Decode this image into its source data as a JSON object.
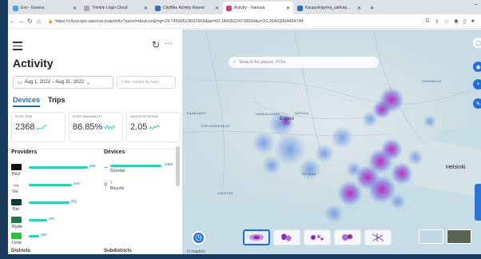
{
  "browser": {
    "tabs": [
      {
        "label": "Esri - Etusivu",
        "color": "#4aa3df",
        "active": false
      },
      {
        "label": "Trimble Login Cloud",
        "color": "#aaaaaa",
        "active": false
      },
      {
        "label": "CityBike Activity Report",
        "color": "#3b6fb6",
        "active": false
      },
      {
        "label": "Activity - Vianova",
        "color": "#d63a8a",
        "active": true
      },
      {
        "label": "Kaupunkipyörä_sähköp...",
        "color": "#2b6cb0",
        "active": false
      }
    ],
    "new_tab": "+",
    "url": "https://cityscope.vianova.io/activity?panel=devices&lng=24.74599523697669&lat=60.18435224728654&z=10.26403064464744"
  },
  "sidebar": {
    "title": "Activity",
    "date_range": "Aug 1, 2022 – Aug 31, 2022",
    "zone_filter_placeholder": "Filter zones by tags",
    "tabs": [
      "Devices",
      "Trips"
    ],
    "stats": [
      {
        "label": "Fleet size",
        "value": "2368"
      },
      {
        "label": "Fleet availability",
        "value": "86.85%"
      },
      {
        "label": "Device rotation",
        "value": "2.05"
      }
    ],
    "providers_heading": "Providers",
    "devices_heading": "Devices",
    "providers": [
      {
        "name": "Bird",
        "value": "889",
        "share": 0.375,
        "color": "#111111"
      },
      {
        "name": "Voi",
        "value": "644",
        "share": 0.272,
        "color": "#e7c7c7"
      },
      {
        "name": "Tier",
        "value": "611",
        "share": 0.258,
        "color": "#0f3b3a"
      },
      {
        "name": "Ryde",
        "value": "267",
        "share": 0.113,
        "color": "#1f7a4d"
      },
      {
        "name": "Lime",
        "value": "158",
        "share": 0.067,
        "color": "#2fbf3a"
      }
    ],
    "devices": [
      {
        "name": "Scooter",
        "value": "2368",
        "share": 1.0,
        "icon": "scooter-icon"
      },
      {
        "name": "Bicycle",
        "value": "1",
        "share": 0.0,
        "icon": "bicycle-icon"
      }
    ],
    "bottom_headings": [
      "Districts",
      "Subdistricts"
    ]
  },
  "map": {
    "search_placeholder": "Search for places, POIs",
    "city_label": "Helsinki",
    "place_labels": [
      "KAUKLAHTI",
      "ESPOONKESKUS",
      "HANKALAINEN",
      "TAPIOLA",
      "ESTAMA",
      "LAGSTAD",
      "Espoo",
      "ITÄKESKUS"
    ],
    "attribution": "© mapbox"
  }
}
